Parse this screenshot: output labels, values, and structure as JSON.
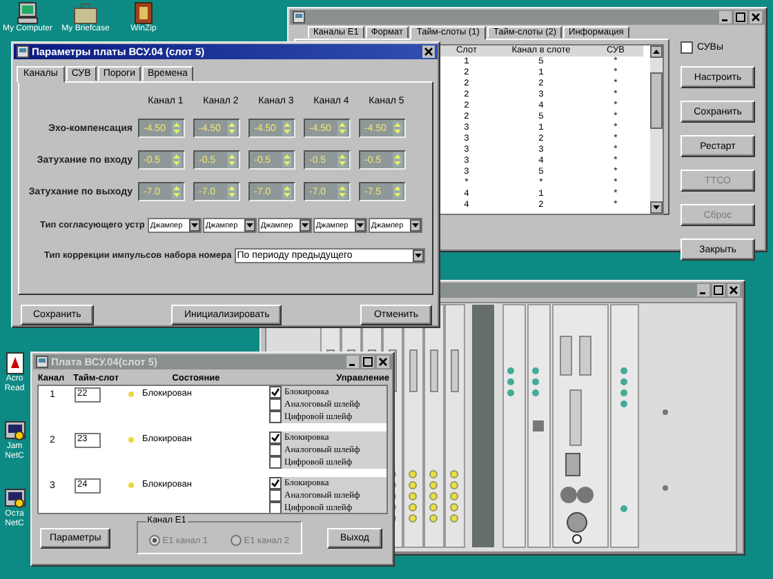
{
  "desktop_icons": [
    {
      "label": "My Computer",
      "kind": "computer"
    },
    {
      "label": "My Briefcase",
      "kind": "briefcase"
    },
    {
      "label": "WinZip",
      "kind": "archive"
    },
    {
      "label": "Acro Read",
      "kind": "document"
    },
    {
      "label": "Jam NetC",
      "kind": "program"
    },
    {
      "label": "Оста NetC",
      "kind": "program"
    }
  ],
  "slots_window": {
    "tabs": [
      {
        "label": "Каналы E1",
        "selected": false
      },
      {
        "label": "Формат",
        "selected": false
      },
      {
        "label": "Тайм-слоты (1)",
        "selected": true
      },
      {
        "label": "Тайм-слоты (2)",
        "selected": false
      },
      {
        "label": "Информация",
        "selected": false
      }
    ],
    "columns": [
      "Слот",
      "Канал в слоте",
      "СУВ"
    ],
    "rows": [
      [
        "1",
        "5",
        "*"
      ],
      [
        "2",
        "1",
        "*"
      ],
      [
        "2",
        "2",
        "*"
      ],
      [
        "2",
        "3",
        "*"
      ],
      [
        "2",
        "4",
        "*"
      ],
      [
        "2",
        "5",
        "*"
      ],
      [
        "3",
        "1",
        "*"
      ],
      [
        "3",
        "2",
        "*"
      ],
      [
        "3",
        "3",
        "*"
      ],
      [
        "3",
        "4",
        "*"
      ],
      [
        "3",
        "5",
        "*"
      ],
      [
        "*",
        "*",
        "*"
      ],
      [
        "4",
        "1",
        "*"
      ],
      [
        "4",
        "2",
        "*"
      ]
    ],
    "suv_checkbox": {
      "label": "СУВы",
      "checked": false
    },
    "buttons": [
      {
        "label": "Настроить",
        "disabled": false
      },
      {
        "label": "Сохранить",
        "disabled": false
      },
      {
        "label": "Рестарт",
        "disabled": false
      },
      {
        "label": "ТТСО",
        "disabled": true
      },
      {
        "label": "Сброс",
        "disabled": true
      },
      {
        "label": "Закрыть",
        "disabled": false
      }
    ]
  },
  "params_dialog": {
    "title": "Параметры платы ВСУ.04 (слот 5)",
    "tabs": [
      {
        "label": "Каналы",
        "selected": true
      },
      {
        "label": "СУВ",
        "selected": false
      },
      {
        "label": "Пороги",
        "selected": false
      },
      {
        "label": "Времена",
        "selected": false
      }
    ],
    "channels": [
      "Канал 1",
      "Канал 2",
      "Канал 3",
      "Канал 4",
      "Канал 5"
    ],
    "rows": [
      {
        "label": "Эхо-компенсация",
        "values": [
          "-4.50",
          "-4.50",
          "-4.50",
          "-4.50",
          "-4.50"
        ]
      },
      {
        "label": "Затухание по входу",
        "values": [
          "-0.5",
          "-0.5",
          "-0.5",
          "-0.5",
          "-0.5"
        ]
      },
      {
        "label": "Затухание по выходу",
        "values": [
          "-7.0",
          "-7.0",
          "-7.0",
          "-7.0",
          "-7.5"
        ]
      }
    ],
    "device_type": {
      "label": "Тип согласующего устр",
      "values": [
        "Джампер",
        "Джампер",
        "Джампер",
        "Джампер",
        "Джампер"
      ]
    },
    "correction": {
      "label": "Тип коррекции импульсов набора номера",
      "value": "По периоду предыдущего"
    },
    "buttons": [
      "Сохранить",
      "Инициализировать",
      "Отменить"
    ]
  },
  "board_dialog": {
    "title": "Плата ВСУ.04(слот 5)",
    "columns": [
      "Канал",
      "Тайм-слот",
      "Состояние",
      "Управление"
    ],
    "channels": [
      {
        "number": "1",
        "timeslot": "22",
        "state": "Блокирован",
        "controls": [
          {
            "label": "Блокировка",
            "checked": true
          },
          {
            "label": "Аналоговый шлейф",
            "checked": false
          },
          {
            "label": "Цифровой шлейф",
            "checked": false
          }
        ]
      },
      {
        "number": "2",
        "timeslot": "23",
        "state": "Блокирован",
        "controls": [
          {
            "label": "Блокировка",
            "checked": true
          },
          {
            "label": "Аналоговый шлейф",
            "checked": false
          },
          {
            "label": "Цифровой шлейф",
            "checked": false
          }
        ]
      },
      {
        "number": "3",
        "timeslot": "24",
        "state": "Блокирован",
        "controls": [
          {
            "label": "Блокировка",
            "checked": true
          },
          {
            "label": "Аналоговый шлейф",
            "checked": false
          },
          {
            "label": "Цифровой шлейф",
            "checked": false
          }
        ]
      }
    ],
    "buttons": [
      "Параметры",
      "Выход"
    ],
    "e1_group": {
      "label": "Канал E1",
      "disabled": true,
      "options": [
        {
          "label": "E1 канал 1",
          "selected": true
        },
        {
          "label": "E1 канал 2",
          "selected": false
        }
      ]
    }
  }
}
